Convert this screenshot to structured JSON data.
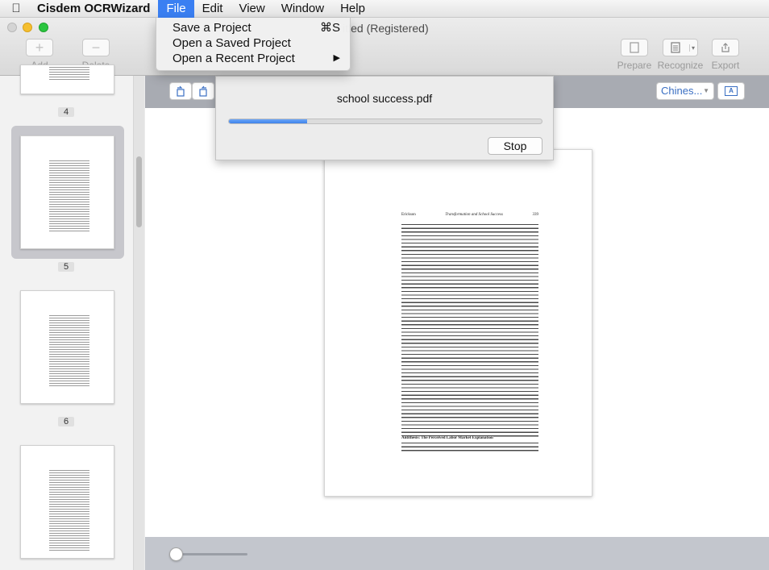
{
  "menubar": {
    "app_name": "Cisdem OCRWizard",
    "items": [
      "File",
      "Edit",
      "View",
      "Window",
      "Help"
    ]
  },
  "window": {
    "title": "itled (Registered)"
  },
  "toolbar": {
    "add_label": "Add",
    "delete_label": "Delete",
    "prepare_label": "Prepare",
    "recognize_label": "Recognize",
    "export_label": "Export"
  },
  "file_menu": {
    "items": [
      {
        "label": "Save a Project",
        "shortcut": "⌘S"
      },
      {
        "label": "Open a Saved Project",
        "shortcut": ""
      },
      {
        "label": "Open a Recent Project",
        "shortcut": "▶"
      }
    ]
  },
  "sidebar": {
    "pages": [
      {
        "number": "4"
      },
      {
        "number": "5",
        "selected": true
      },
      {
        "number": "6"
      }
    ]
  },
  "doc_toolbar": {
    "language": "Chines..."
  },
  "progress": {
    "file_name": "school success.pdf",
    "percent": 25,
    "stop_label": "Stop"
  },
  "document": {
    "header_left": "Erickson",
    "header_center": "Transformation and School Success",
    "header_right": "339",
    "section_heading": "Antithesis: The Perceived Labor Market Explanation"
  },
  "colors": {
    "accent": "#3a7ff2",
    "progress": "#3f82ea",
    "selection": "#c7c7cc"
  }
}
